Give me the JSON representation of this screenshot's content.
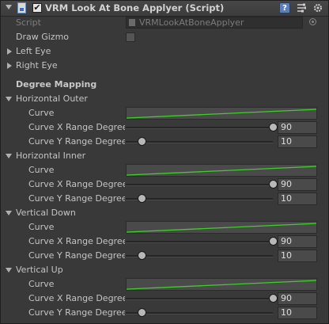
{
  "header": {
    "title": "VRM Look At Bone Applyer (Script)",
    "enabled": "✔",
    "help_label": "?",
    "preset_icon": "preset-icon",
    "gear_icon": "gear-icon"
  },
  "fields": {
    "script_label": "Script",
    "script_value": "VRMLookAtBoneApplyer",
    "draw_gizmo_label": "Draw Gizmo",
    "left_eye_label": "Left Eye",
    "right_eye_label": "Right Eye"
  },
  "section_title": "Degree Mapping",
  "mappings": [
    {
      "label": "Horizontal Outer",
      "curve_label": "Curve",
      "x_label": "Curve X Range Degree",
      "x_value": "90",
      "x_fraction": 1.0,
      "y_label": "Curve Y Range Degree",
      "y_value": "10",
      "y_fraction": 0.11
    },
    {
      "label": "Horizontal Inner",
      "curve_label": "Curve",
      "x_label": "Curve X Range Degree",
      "x_value": "90",
      "x_fraction": 1.0,
      "y_label": "Curve Y Range Degree",
      "y_value": "10",
      "y_fraction": 0.11
    },
    {
      "label": "Vertical Down",
      "curve_label": "Curve",
      "x_label": "Curve X Range Degree",
      "x_value": "90",
      "x_fraction": 1.0,
      "y_label": "Curve Y Range Degree",
      "y_value": "10",
      "y_fraction": 0.11
    },
    {
      "label": "Vertical Up",
      "curve_label": "Curve",
      "x_label": "Curve X Range Degree",
      "x_value": "90",
      "x_fraction": 1.0,
      "y_label": "Curve Y Range Degree",
      "y_value": "10",
      "y_fraction": 0.11
    }
  ],
  "colors": {
    "curve": "#3ecf2a",
    "panel": "#393939"
  }
}
